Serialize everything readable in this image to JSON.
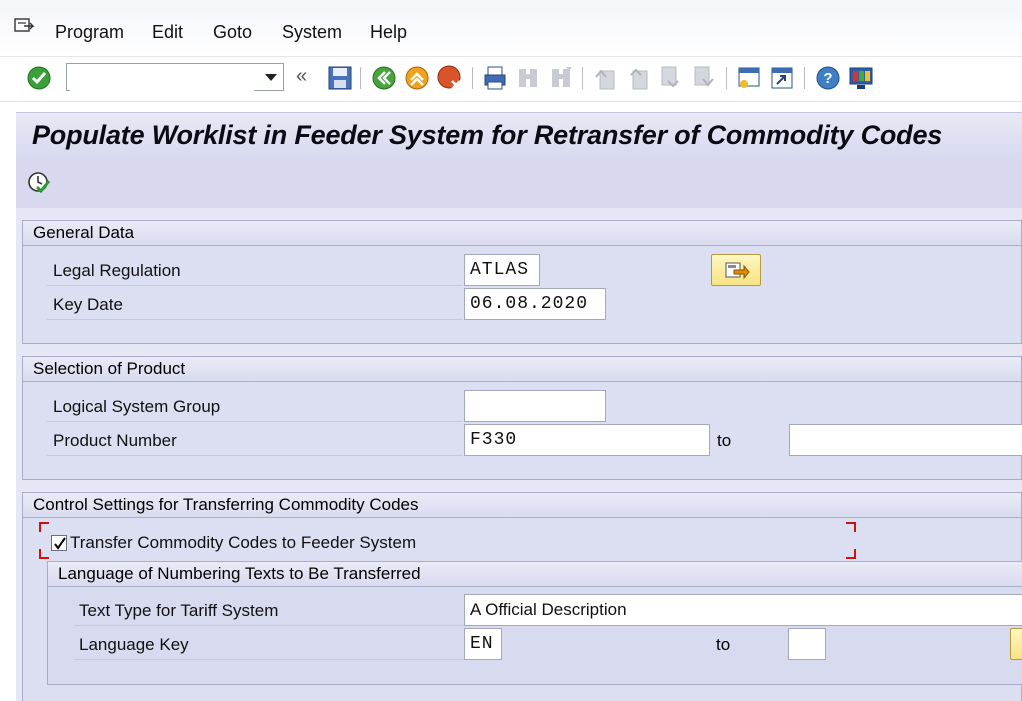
{
  "menu": {
    "items": [
      "Program",
      "Edit",
      "Goto",
      "System",
      "Help"
    ]
  },
  "toolbar": {
    "command_field": {
      "value": ""
    }
  },
  "page": {
    "title": "Populate Worklist in Feeder System for Retransfer of Commodity Codes"
  },
  "general_data": {
    "header": "General Data",
    "legal_regulation_label": "Legal Regulation",
    "legal_regulation_value": "ATLAS",
    "key_date_label": "Key Date",
    "key_date_value": "06.08.2020"
  },
  "selection": {
    "header": "Selection of Product",
    "logical_system_group_label": "Logical System Group",
    "logical_system_group_value": "",
    "product_number_label": "Product Number",
    "product_number_from": "F330",
    "to_label": "to",
    "product_number_to": ""
  },
  "control": {
    "header": "Control Settings for Transferring Commodity Codes",
    "transfer_checkbox_label": "Transfer Commodity Codes to Feeder System",
    "transfer_checked": true,
    "language_group": {
      "header": "Language of Numbering Texts to Be Transferred",
      "text_type_label": "Text Type for Tariff System",
      "text_type_value": "A Official Description",
      "language_key_label": "Language Key",
      "language_key_from": "EN",
      "to_label": "to",
      "language_key_to": ""
    }
  },
  "colors": {
    "title_text": "#0b0b14",
    "panel_bg": "#e6e7f5",
    "group_bg": "#dcdff1",
    "selection_marker": "#cc1111"
  }
}
